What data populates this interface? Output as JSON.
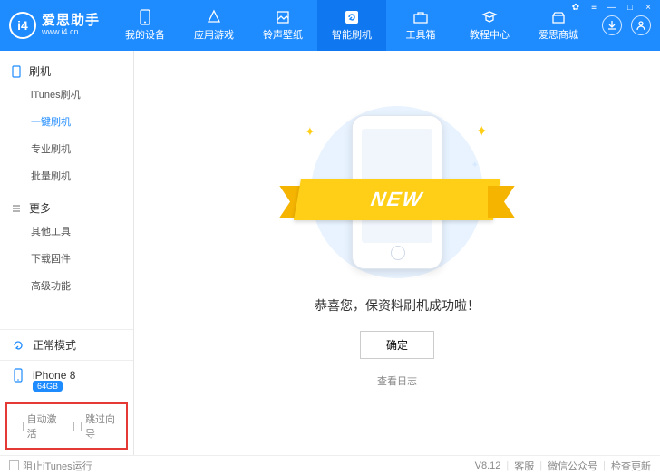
{
  "brand": {
    "name": "爱思助手",
    "url": "www.i4.cn",
    "logo_text": "i4"
  },
  "win": {
    "settings": "✿",
    "menu": "≡",
    "min": "—",
    "max": "□",
    "close": "×"
  },
  "tabs": [
    {
      "id": "devices",
      "label": "我的设备",
      "active": false
    },
    {
      "id": "apps",
      "label": "应用游戏",
      "active": false
    },
    {
      "id": "ring",
      "label": "铃声壁纸",
      "active": false
    },
    {
      "id": "flash",
      "label": "智能刷机",
      "active": true
    },
    {
      "id": "tools",
      "label": "工具箱",
      "active": false
    },
    {
      "id": "tutorial",
      "label": "教程中心",
      "active": false
    },
    {
      "id": "mall",
      "label": "爱思商城",
      "active": false
    }
  ],
  "header_icons": {
    "download": "↓",
    "user": "◯"
  },
  "sidebar": {
    "groups": [
      {
        "title": "刷机",
        "items": [
          {
            "id": "itunes",
            "label": "iTunes刷机",
            "active": false
          },
          {
            "id": "onekey",
            "label": "一键刷机",
            "active": true
          },
          {
            "id": "pro",
            "label": "专业刷机",
            "active": false
          },
          {
            "id": "batch",
            "label": "批量刷机",
            "active": false
          }
        ]
      },
      {
        "title": "更多",
        "items": [
          {
            "id": "other",
            "label": "其他工具",
            "active": false
          },
          {
            "id": "fw",
            "label": "下载固件",
            "active": false
          },
          {
            "id": "adv",
            "label": "高级功能",
            "active": false
          }
        ]
      }
    ],
    "mode": "正常模式",
    "device": {
      "name": "iPhone 8",
      "storage": "64GB"
    },
    "options": [
      {
        "id": "auto",
        "label": "自动激活"
      },
      {
        "id": "skip",
        "label": "跳过向导"
      }
    ]
  },
  "main": {
    "ribbon": "NEW",
    "message": "恭喜您，保资料刷机成功啦！",
    "ok": "确定",
    "view_log": "查看日志"
  },
  "footer": {
    "block_itunes": "阻止iTunes运行",
    "version": "V8.12",
    "support": "客服",
    "wechat": "微信公众号",
    "update": "检查更新"
  }
}
